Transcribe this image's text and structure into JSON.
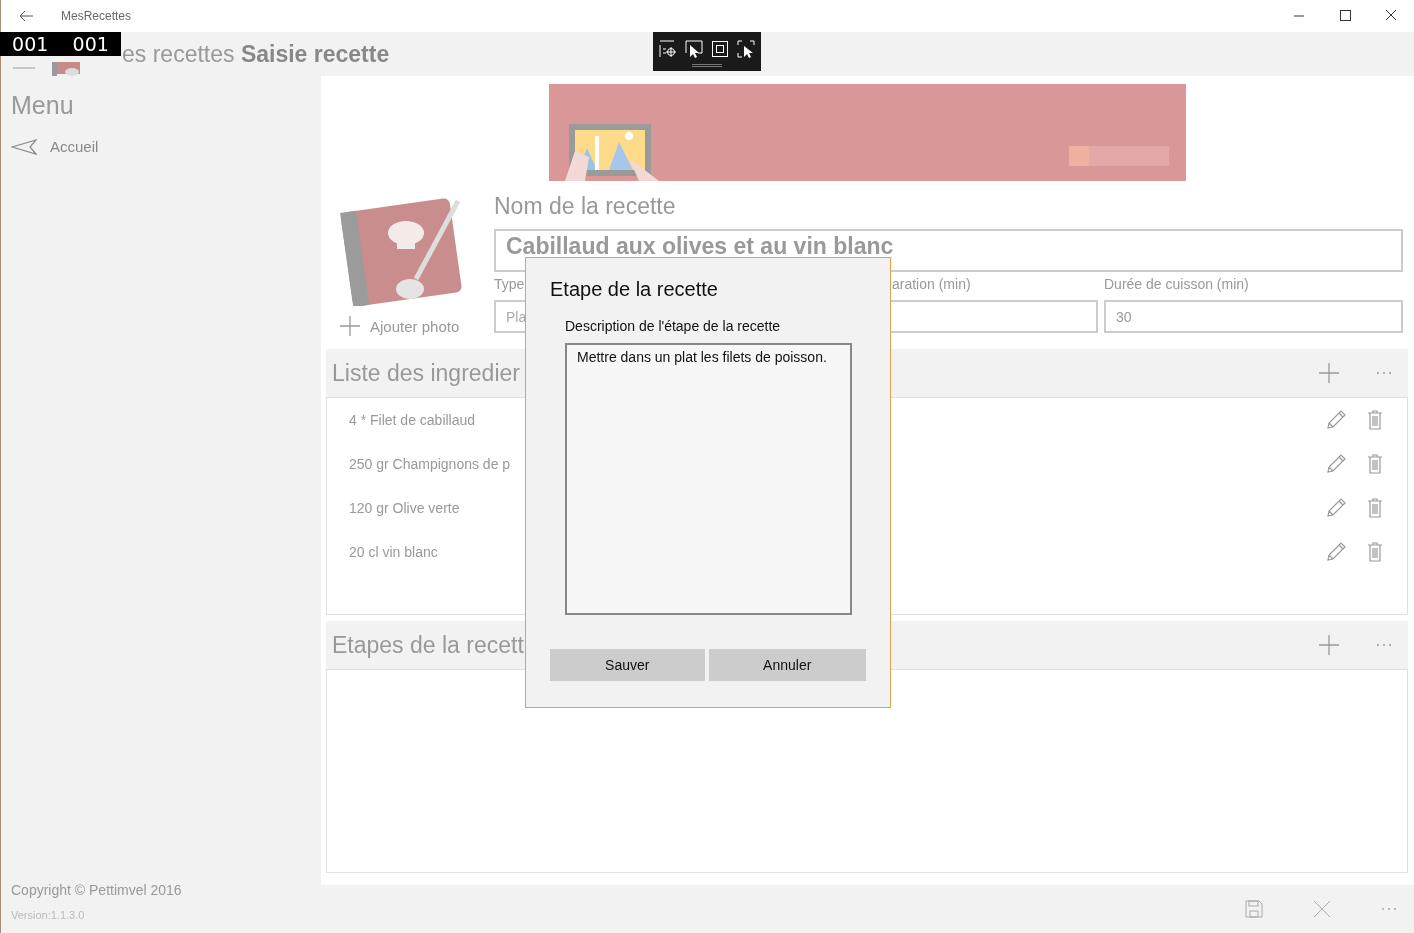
{
  "window": {
    "title": "MesRecettes"
  },
  "frame_counter": [
    "001",
    "001"
  ],
  "header": {
    "title": "es recettes **Saisie recette**"
  },
  "sidebar": {
    "title": "Menu",
    "items": [
      {
        "label": "Accueil"
      }
    ],
    "copyright": "Copyright © Pettimvel 2016",
    "version": "Version:1.1.3.0"
  },
  "banner": {
    "kind": "picture"
  },
  "recipe": {
    "photo_button": "Ajouter photo",
    "name_label": "Nom de la recette",
    "name": "Cabillaud aux olives et au vin blanc",
    "fields": [
      {
        "label": "Type",
        "placeholder": "Pla"
      },
      {
        "label": "aration (min)"
      },
      {
        "label": "Durée de cuisson (min)",
        "value": "30"
      }
    ]
  },
  "ingredients": {
    "title": "Liste des ingredier",
    "items": [
      {
        "quantity": "4",
        "unit": "*",
        "name": "Filet de cabillaud"
      },
      {
        "quantity": "250",
        "unit": "gr",
        "name": "Champignons de p"
      },
      {
        "quantity": "120",
        "unit": "gr",
        "name": "Olive verte"
      },
      {
        "quantity": "20",
        "unit": "cl",
        "name": "vin blanc"
      }
    ]
  },
  "steps": {
    "title": "Etapes de la recett"
  },
  "dialog": {
    "title": "Etape de la recette",
    "label": "Description de l'étape de la recette",
    "value": "Mettre dans un plat les filets de poisson.",
    "buttons": [
      "Sauver",
      "Annuler"
    ]
  }
}
